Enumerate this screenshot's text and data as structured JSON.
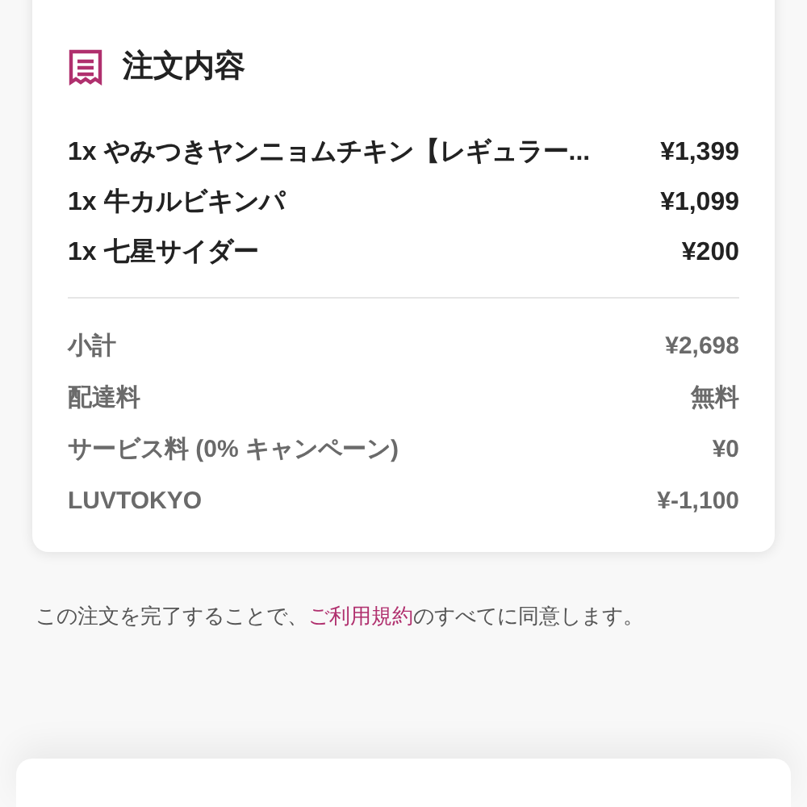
{
  "order": {
    "title": "注文内容",
    "items": [
      {
        "quantity": "1x",
        "name": "やみつきヤンニョムチキン【レギュラー...",
        "price": "¥1,399"
      },
      {
        "quantity": "1x",
        "name": "牛カルビキンパ",
        "price": "¥1,099"
      },
      {
        "quantity": "1x",
        "name": "七星サイダー",
        "price": "¥200"
      }
    ],
    "summary": [
      {
        "label": "小計",
        "value": "¥2,698"
      },
      {
        "label": "配達料",
        "value": "無料"
      },
      {
        "label": "サービス料 (0% キャンペーン)",
        "value": "¥0"
      },
      {
        "label": "LUVTOKYO",
        "value": "¥-1,100"
      }
    ]
  },
  "terms": {
    "before": "この注文を完了することで、",
    "link": "ご利用規約",
    "after": "のすべてに同意します。"
  }
}
